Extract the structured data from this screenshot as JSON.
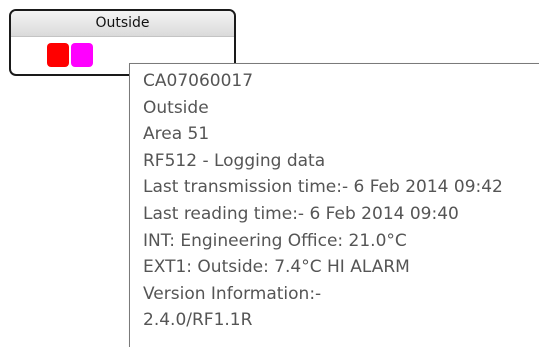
{
  "widget": {
    "title": "Outside",
    "indicators": [
      {
        "name": "red-status",
        "color": "#ff0000"
      },
      {
        "name": "magenta-status",
        "color": "#ff00ff"
      }
    ]
  },
  "tooltip": {
    "lines": [
      "CA07060017",
      "Outside",
      "Area 51",
      "RF512 - Logging data",
      "Last transmission time:- 6 Feb 2014 09:42",
      "Last reading time:- 6 Feb 2014 09:40",
      "INT: Engineering Office: 21.0°C",
      "EXT1: Outside: 7.4°C HI ALARM",
      "Version Information:-",
      "2.4.0/RF1.1R"
    ]
  },
  "colors": {
    "tooltip_text": "#555555",
    "widget_border": "#1a1a1a"
  }
}
